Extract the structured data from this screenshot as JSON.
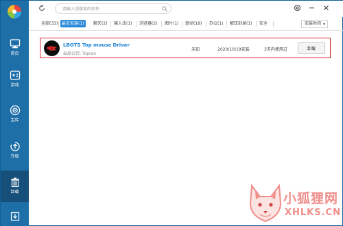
{
  "sidebar": {
    "logo_icon": "pinwheel-logo-icon",
    "items": [
      {
        "label": "首页",
        "icon": "monitor-icon"
      },
      {
        "label": "游戏",
        "icon": "gamepad-icon"
      },
      {
        "label": "宝库",
        "icon": "treasure-icon"
      },
      {
        "label": "升级",
        "icon": "upgrade-icon"
      },
      {
        "label": "卸载",
        "icon": "trash-icon",
        "active": true
      }
    ],
    "bottom_icon": "download-icon"
  },
  "topbar": {
    "search_placeholder": "请输入想搜索的软件",
    "controls": [
      "settings-icon",
      "minimize-icon",
      "close-icon"
    ]
  },
  "tabs": [
    {
      "label": "全部(33)"
    },
    {
      "label": "最近安装(1)",
      "active": true
    },
    {
      "label": "聊天(2)"
    },
    {
      "label": "输入法(1)"
    },
    {
      "label": "浏览器(2)"
    },
    {
      "label": "图片(1)"
    },
    {
      "label": "驱动(18)"
    },
    {
      "label": "办公(1)"
    },
    {
      "label": "解压刻录(1)"
    },
    {
      "label": "安全"
    }
  ],
  "sort": {
    "label": "安装时间"
  },
  "apps": [
    {
      "name": "LBOTS Top mouse Driver",
      "publisher": "出品公司: Topran",
      "size": "未知",
      "install_date": "2020/10/19安装",
      "last_used": "3天内使用过",
      "action_label": "卸载",
      "icon": "mouse-driver-app-icon"
    }
  ],
  "watermark": {
    "cn": "小狐狸网",
    "en": "XHLKS.CN",
    "icon": "fox-watermark-icon"
  },
  "colors": {
    "sidebar": "#1e6ea8",
    "sidebar_active": "#164f7a",
    "accent": "#2b8ad8",
    "highlight_border": "#d12a2a",
    "watermark": "#f08e8a"
  }
}
